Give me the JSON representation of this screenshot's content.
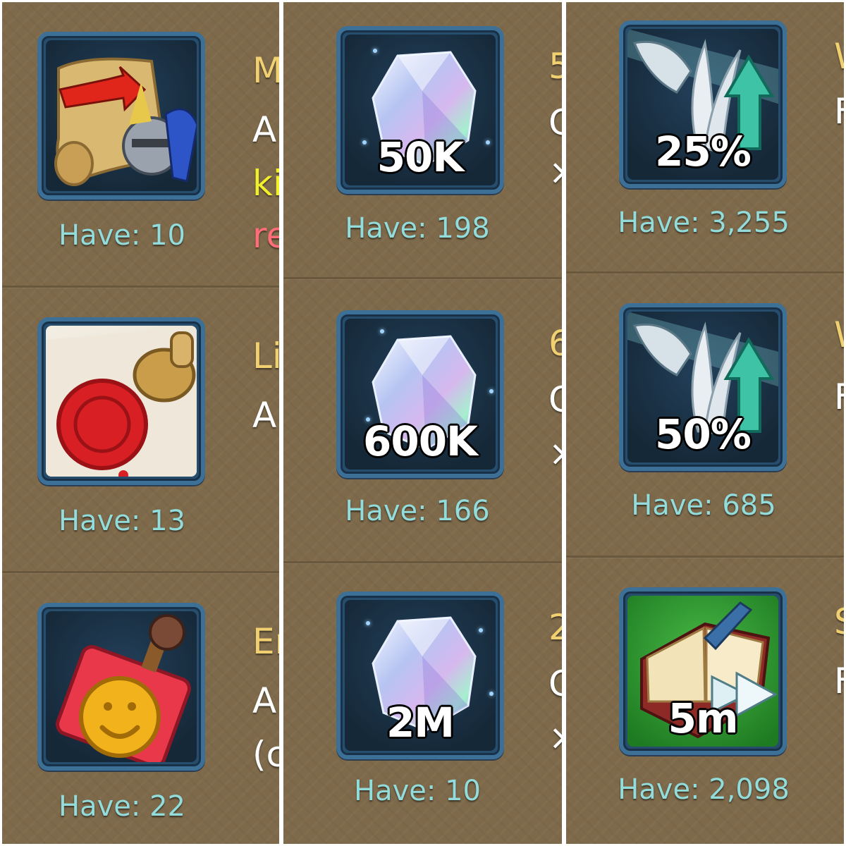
{
  "columns": [
    {
      "items": [
        {
          "icon": "kingdom-scroll-knight-icon",
          "have": "Have: 10",
          "side": [
            "M",
            "A",
            "ki",
            "re"
          ]
        },
        {
          "icon": "wax-seal-stamp-icon",
          "have": "Have: 13",
          "side": [
            "Li",
            "A"
          ]
        },
        {
          "icon": "gold-stamp-icon",
          "have": "Have: 22",
          "side": [
            "Er",
            "A",
            "(c"
          ]
        }
      ]
    },
    {
      "items": [
        {
          "icon": "gem-icon",
          "amount": "50K",
          "have": "Have: 198",
          "side": [
            "5",
            "C",
            "×"
          ]
        },
        {
          "icon": "gem-icon",
          "amount": "600K",
          "have": "Have: 166",
          "side": [
            "6",
            "C",
            "×"
          ]
        },
        {
          "icon": "gem-icon",
          "amount": "2M",
          "have": "Have: 10",
          "side": [
            "2",
            "C",
            "×"
          ]
        }
      ]
    },
    {
      "items": [
        {
          "icon": "wing-boost-arrow-icon",
          "amount": "25%",
          "have": "Have: 3,255",
          "side": [
            "W",
            "F"
          ]
        },
        {
          "icon": "wing-boost-arrow-icon",
          "amount": "50%",
          "have": "Have: 685",
          "side": [
            "W",
            "F"
          ]
        },
        {
          "icon": "research-book-speedup-icon",
          "amount": "5m",
          "have": "Have: 2,098",
          "side": [
            "S",
            "F"
          ]
        }
      ]
    }
  ],
  "colors": {
    "panel": "#7e6a4b",
    "frame_border": "#3d7096",
    "have_text": "#92dcdc",
    "title_text": "#f0d071",
    "highlight_yellow": "#f2f02a",
    "highlight_red": "#ff6d78"
  }
}
